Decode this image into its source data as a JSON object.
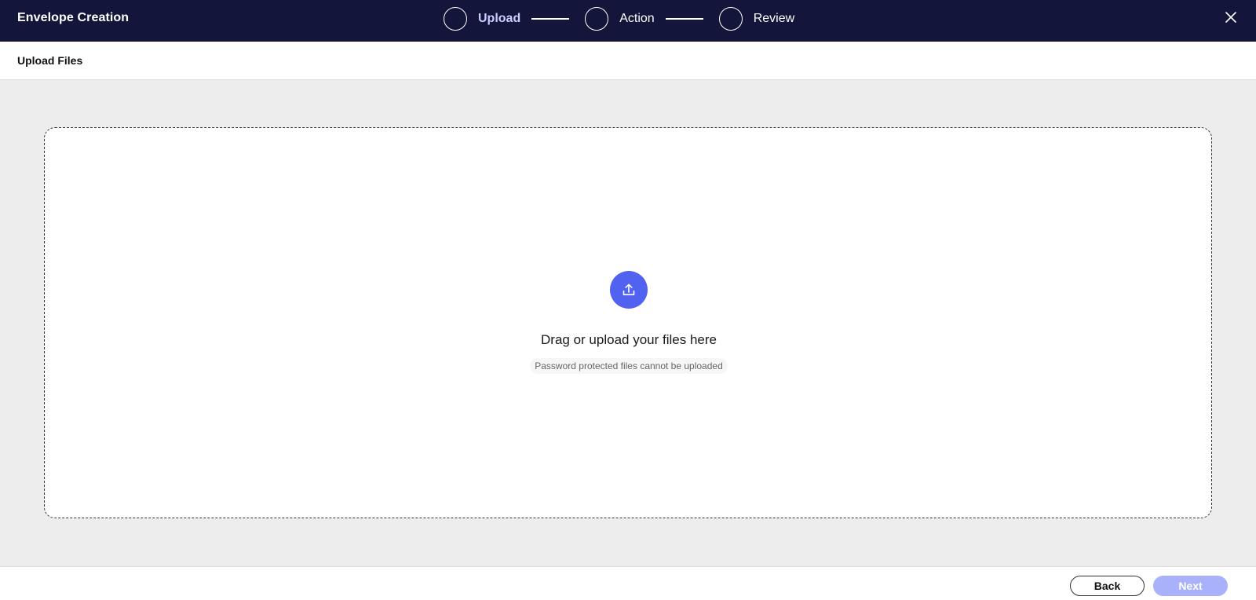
{
  "header": {
    "title": "Envelope Creation",
    "close_icon": "close-icon",
    "steps": [
      {
        "label": "Upload",
        "active": true
      },
      {
        "label": "Action",
        "active": false
      },
      {
        "label": "Review",
        "active": false
      }
    ]
  },
  "subheader": {
    "title": "Upload Files"
  },
  "dropzone": {
    "icon": "upload-icon",
    "text": "Drag or upload your files here",
    "hint": "Password protected files cannot be uploaded"
  },
  "footer": {
    "back_label": "Back",
    "next_label": "Next"
  },
  "colors": {
    "header_bg": "#13163a",
    "accent": "#5262f0",
    "next_disabled": "#a9b1fb"
  }
}
